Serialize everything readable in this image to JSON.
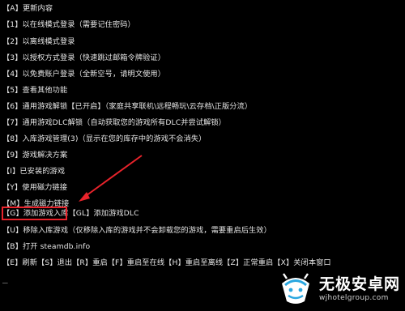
{
  "console": {
    "lines": [
      "【A】更新内容",
      "【1】以在线模式登录（需要记住密码）",
      "【2】以离线模式登录",
      "【3】以授权方式登录（快速跳过邮箱令牌验证）",
      "【4】以免费账户登录（全新空号，请明文使用）",
      "【5】查看其他功能",
      "【6】通用游戏解锁【已开启】（家庭共享联机\\远程畅玩\\云存档\\正版分流）",
      "【7】通用游戏DLC解锁（自动获取您的游戏所有DLC并尝试解锁）",
      "【8】入库游戏管理(3)（显示在您的库存中的游戏不会消失）",
      "【9】游戏解决方案",
      "【I】已安装的游戏",
      "【Y】使用磁力链接",
      "【M】生成磁力链接",
      "【G】添加游戏入库【GL】添加游戏DLC",
      "【U】移除入库游戏（仅移除入库的游戏并不会卸载您的游戏，需要重启后生效）",
      "【B】打开 steamdb.info",
      "【E】刷新【S】退出【R】重启【F】重启至在线【H】重启至离线【Z】正常重启【X】关闭本窗口"
    ],
    "prompt": "_"
  },
  "annotation": {
    "box_color": "#e8232b",
    "arrow_color": "#e8232b"
  },
  "watermark": {
    "title": "无极安卓网",
    "url": "wjhotelgroup.com",
    "logo_icon": "android-logo-icon",
    "accent": "#2aa7e0"
  }
}
